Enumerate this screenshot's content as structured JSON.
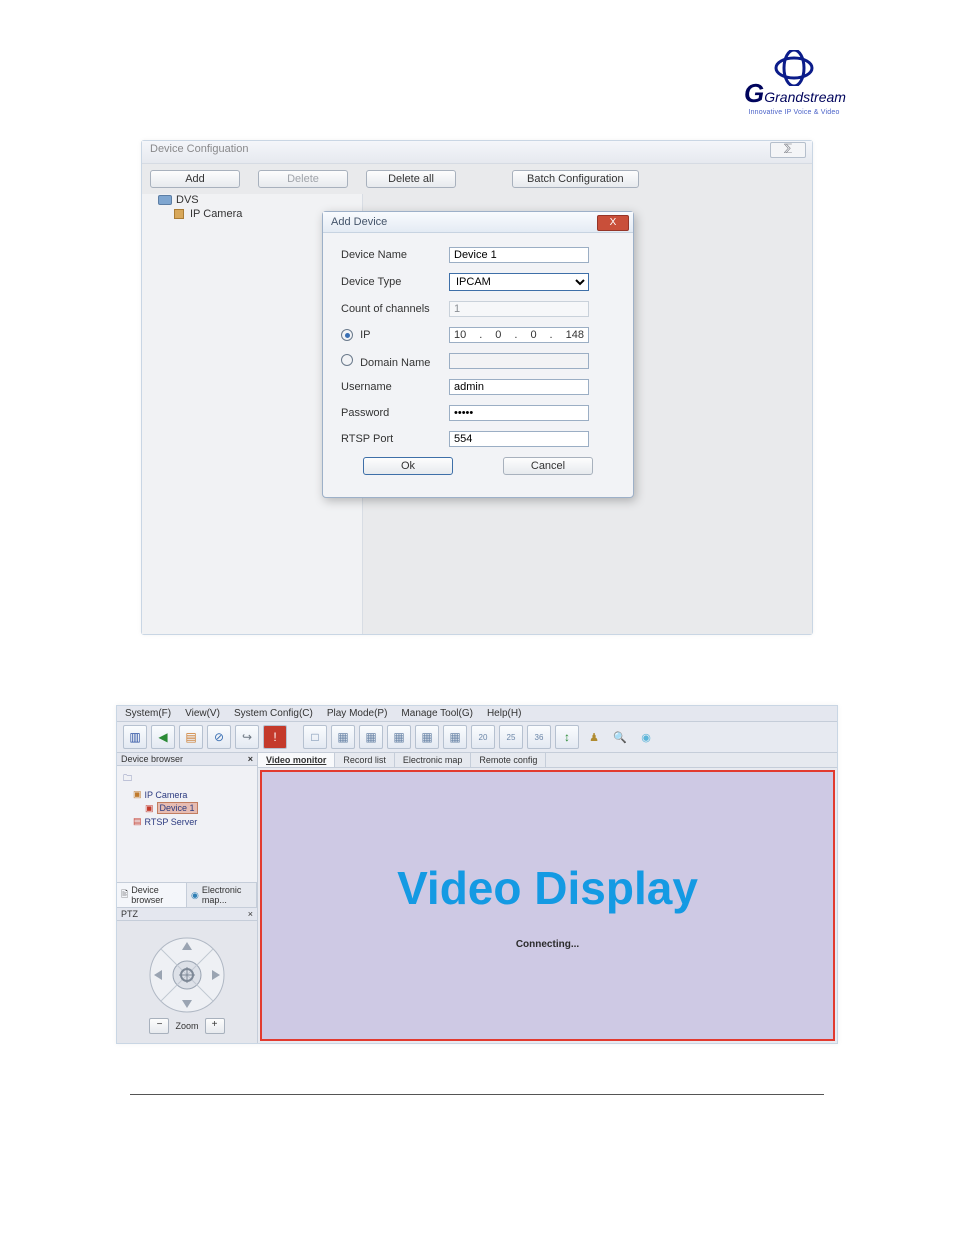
{
  "logo": {
    "brand": "Grandstream",
    "tag": "Innovative IP Voice & Video"
  },
  "shot1": {
    "title": "Device Configuation",
    "close_glyph": "⅀",
    "toolbar": {
      "add": "Add",
      "delete": "Delete",
      "delete_all": "Delete all",
      "batch": "Batch Configuration"
    },
    "tree": {
      "dvs": "DVS",
      "ipcam": "IP Camera"
    },
    "dialog": {
      "title": "Add Device",
      "close": "X",
      "labels": {
        "device_name": "Device Name",
        "device_type": "Device Type",
        "channels": "Count of channels",
        "ip": "IP",
        "domain": "Domain Name",
        "username": "Username",
        "password": "Password",
        "rtsp": "RTSP Port"
      },
      "values": {
        "device_name": "Device 1",
        "device_type": "IPCAM",
        "channels": "1",
        "ip": {
          "a": "10",
          "b": "0",
          "c": "0",
          "d": "148"
        },
        "domain": "",
        "username": "admin",
        "password": "•••••",
        "rtsp": "554"
      },
      "ok": "Ok",
      "cancel": "Cancel"
    }
  },
  "shot2": {
    "menu": {
      "system": "System(F)",
      "view": "View(V)",
      "config": "System Config(C)",
      "play": "Play Mode(P)",
      "manage": "Manage Tool(G)",
      "help": "Help(H)"
    },
    "panels": {
      "device_browser": "Device browser",
      "ptz": "PTZ",
      "close": "×"
    },
    "tree": {
      "root_blank": "",
      "ipcam": "IP Camera",
      "dev1": "Device 1",
      "rtsp": "RTSP Server"
    },
    "bottom_tabs": {
      "device": "Device browser",
      "emap": "Electronic map..."
    },
    "top_tabs": {
      "monitor": "Video monitor",
      "record": "Record list",
      "emap": "Electronic map",
      "remote": "Remote config"
    },
    "zoom": {
      "label": "Zoom",
      "minus": "−",
      "plus": "+"
    },
    "video": {
      "big": "Video Display",
      "status": "Connecting..."
    }
  }
}
